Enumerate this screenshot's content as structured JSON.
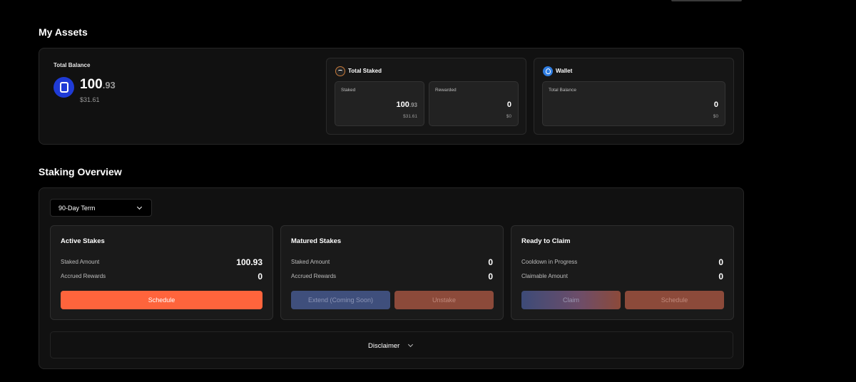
{
  "my_assets": {
    "title": "My Assets",
    "total_balance_label": "Total Balance",
    "balance_int": "100",
    "balance_dec": ".93",
    "balance_usd": "$31.61",
    "total_staked": {
      "title": "Total Staked",
      "staked": {
        "label": "Staked",
        "value_int": "100",
        "value_dec": ".93",
        "usd": "$31.61"
      },
      "rewarded": {
        "label": "Rewarded",
        "value": "0",
        "usd": "$0"
      }
    },
    "wallet": {
      "title": "Wallet",
      "total_balance": {
        "label": "Total Balance",
        "value": "0",
        "usd": "$0"
      }
    }
  },
  "staking_overview": {
    "title": "Staking Overview",
    "term_select": "90-Day Term",
    "active": {
      "title": "Active Stakes",
      "staked_label": "Staked Amount",
      "staked_value": "100.93",
      "rewards_label": "Accrued Rewards",
      "rewards_value": "0",
      "schedule_button": "Schedule"
    },
    "matured": {
      "title": "Matured Stakes",
      "staked_label": "Staked Amount",
      "staked_value": "0",
      "rewards_label": "Accrued Rewards",
      "rewards_value": "0",
      "extend_button": "Extend (Coming Soon)",
      "unstake_button": "Unstake"
    },
    "ready": {
      "title": "Ready to Claim",
      "cooldown_label": "Cooldown in Progress",
      "cooldown_value": "0",
      "claimable_label": "Claimable Amount",
      "claimable_value": "0",
      "claim_button": "Claim",
      "schedule_button": "Schedule"
    },
    "disclaimer": "Disclaimer"
  },
  "colors": {
    "accent_orange": "#ff643c",
    "token_blue": "#1f3bd6",
    "wallet_blue": "#2f7de1"
  }
}
